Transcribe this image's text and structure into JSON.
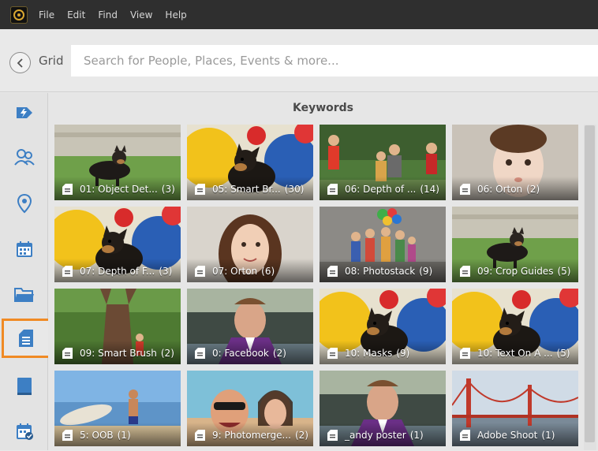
{
  "menubar": {
    "logo_icon": "photoshop-elements-logo-icon",
    "items": [
      "File",
      "Edit",
      "Find",
      "View",
      "Help"
    ]
  },
  "search": {
    "back_icon": "chevron-left-icon",
    "grid_label": "Grid",
    "placeholder": "Search for People, Places, Events & more..."
  },
  "leftnav": {
    "items": [
      {
        "name": "smart-tags",
        "icon": "lightning-tag-icon",
        "active": false
      },
      {
        "name": "people",
        "icon": "people-icon",
        "active": false
      },
      {
        "name": "places",
        "icon": "map-pin-icon",
        "active": false
      },
      {
        "name": "dates",
        "icon": "calendar-icon",
        "active": false
      },
      {
        "name": "folders",
        "icon": "folder-icon",
        "active": false
      },
      {
        "name": "keywords",
        "icon": "keyword-tag-icon",
        "active": true
      },
      {
        "name": "albums",
        "icon": "album-icon",
        "active": false
      },
      {
        "name": "events",
        "icon": "event-calendar-icon",
        "active": false
      }
    ],
    "accent_color": "#f08a24"
  },
  "main": {
    "title": "Keywords",
    "tiles": [
      {
        "name": "01: Object Det...",
        "count": "(3)",
        "scene": "dog-grass"
      },
      {
        "name": "05: Smart Br...",
        "count": "(30)",
        "scene": "dog-balls"
      },
      {
        "name": "06: Depth of ...",
        "count": "(14)",
        "scene": "kids-park"
      },
      {
        "name": "06: Orton",
        "count": "(2)",
        "scene": "baby"
      },
      {
        "name": "07: Depth of F...",
        "count": "(3)",
        "scene": "dog-balls"
      },
      {
        "name": "07: Orton",
        "count": "(6)",
        "scene": "woman"
      },
      {
        "name": "08: Photostack",
        "count": "(9)",
        "scene": "kids-balloons"
      },
      {
        "name": "09: Crop Guides",
        "count": "(5)",
        "scene": "dog-grass"
      },
      {
        "name": "09: Smart Brush",
        "count": "(2)",
        "scene": "tree"
      },
      {
        "name": "0: Facebook",
        "count": "(2)",
        "scene": "man-stadium"
      },
      {
        "name": "10: Masks",
        "count": "(9)",
        "scene": "dog-balls"
      },
      {
        "name": "10: Text On A ...",
        "count": "(5)",
        "scene": "dog-balls"
      },
      {
        "name": "5: OOB",
        "count": "(1)",
        "scene": "beach-surfer"
      },
      {
        "name": "9: Photomerge...",
        "count": "(2)",
        "scene": "couple-selfie"
      },
      {
        "name": "_andy poster",
        "count": "(1)",
        "scene": "man-stadium"
      },
      {
        "name": "Adobe Shoot",
        "count": "(1)",
        "scene": "golden-gate"
      }
    ]
  }
}
